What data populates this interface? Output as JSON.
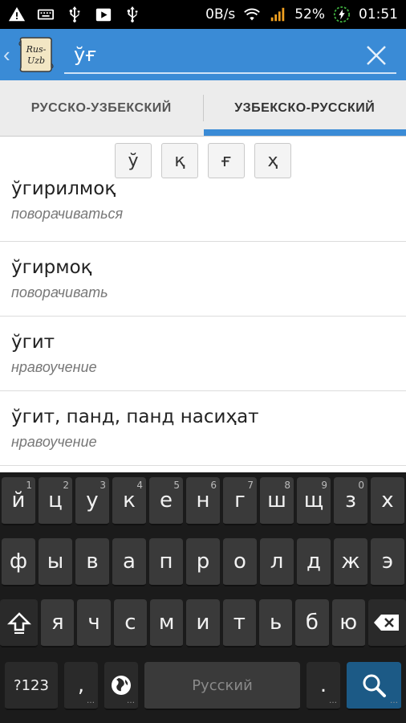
{
  "status_bar": {
    "network_speed": "0B/s",
    "battery": "52%",
    "time": "01:51",
    "icons": [
      "warning-icon",
      "keyboard-icon",
      "usb-icon",
      "play-store-icon",
      "usb-icon",
      "wifi-icon",
      "signal-icon",
      "battery-charging-icon"
    ]
  },
  "app_bar": {
    "logo_text_top": "Rus-",
    "logo_text_bottom": "Uzb",
    "search_value": "ўғ",
    "accent_color": "#3a8bd6"
  },
  "tabs": [
    {
      "label": "РУССКО-УЗБЕКСКИЙ",
      "active": false
    },
    {
      "label": "УЗБЕКСКО-РУССКИЙ",
      "active": true
    }
  ],
  "special_chars": [
    "ў",
    "қ",
    "ғ",
    "ҳ"
  ],
  "results": [
    {
      "word": "ўгирилмоқ",
      "translation": "поворачиваться"
    },
    {
      "word": "ўгирмоқ",
      "translation": "поворачивать"
    },
    {
      "word": "ўгит",
      "translation": "нравоучение"
    },
    {
      "word": "ўгит, панд, панд насиҳат",
      "translation": "нравоучение"
    }
  ],
  "keyboard": {
    "row1": [
      {
        "k": "й",
        "n": "1"
      },
      {
        "k": "ц",
        "n": "2"
      },
      {
        "k": "у",
        "n": "3"
      },
      {
        "k": "к",
        "n": "4"
      },
      {
        "k": "е",
        "n": "5"
      },
      {
        "k": "н",
        "n": "6"
      },
      {
        "k": "г",
        "n": "7"
      },
      {
        "k": "ш",
        "n": "8"
      },
      {
        "k": "щ",
        "n": "9"
      },
      {
        "k": "з",
        "n": "0"
      },
      {
        "k": "х",
        "n": ""
      }
    ],
    "row2": [
      "ф",
      "ы",
      "в",
      "а",
      "п",
      "р",
      "о",
      "л",
      "д",
      "ж",
      "э"
    ],
    "row3": [
      "я",
      "ч",
      "с",
      "м",
      "и",
      "т",
      "ь",
      "б",
      "ю"
    ],
    "symbols_label": "?123",
    "comma": ",",
    "space_label": "Русский",
    "period": "."
  }
}
